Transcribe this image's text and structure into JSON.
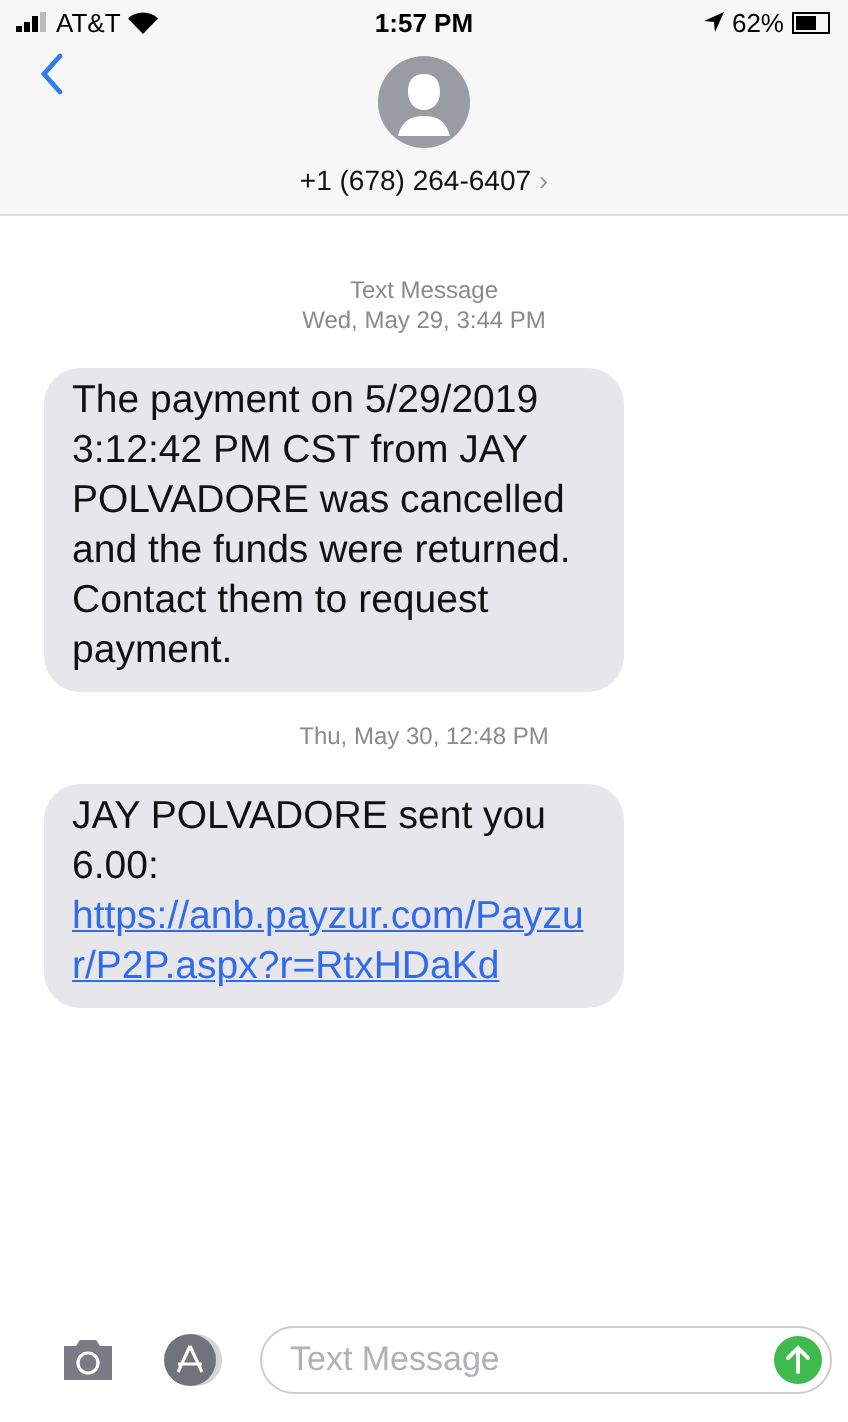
{
  "status_bar": {
    "carrier": "AT&T",
    "time": "1:57 PM",
    "battery": "62%"
  },
  "header": {
    "contact": "+1 (678) 264-6407",
    "chevron": "›"
  },
  "thread": [
    {
      "kind": "timestamp",
      "label": "Text Message",
      "time": "Wed, May 29, 3:44 PM"
    },
    {
      "kind": "message",
      "text": "The payment on 5/29/2019 3:12:42 PM CST from JAY POLVADORE was cancelled and the funds were returned.  Contact them to request payment."
    },
    {
      "kind": "timestamp",
      "time": "Thu, May 30, 12:48 PM"
    },
    {
      "kind": "message",
      "text": "JAY POLVADORE sent you 6.00: ",
      "link": "https://anb.payzur.com/Payzur/P2P.aspx?r=RtxHDaKd"
    }
  ],
  "composer": {
    "placeholder": "Text Message"
  }
}
